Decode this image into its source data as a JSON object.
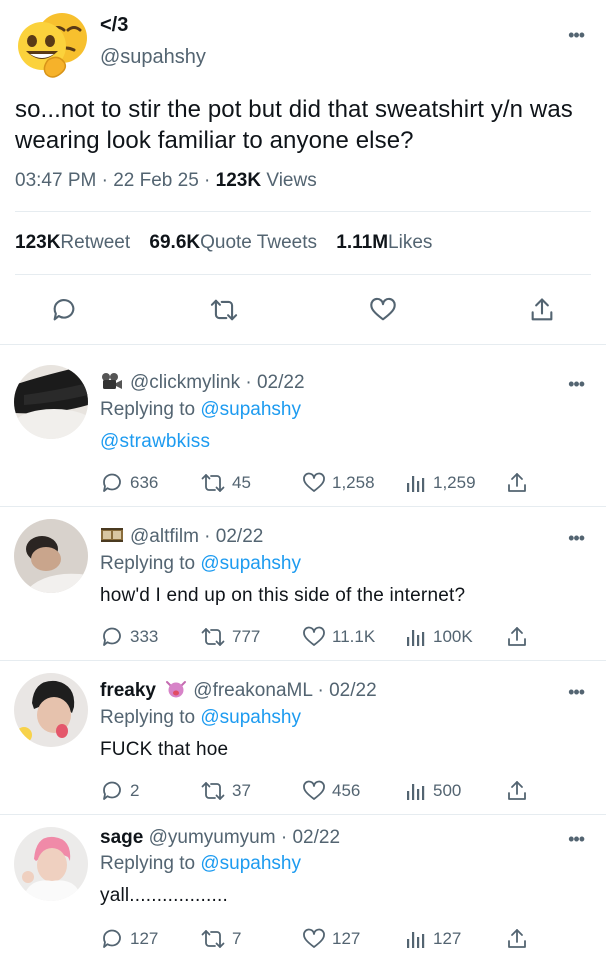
{
  "main": {
    "display_name": "</3",
    "handle": "@supahshy",
    "text": "so...not to stir the pot but did that sweatshirt y/n was wearing look familiar to anyone else?",
    "time": "03:47 PM · 22 Feb 25 · ",
    "views_count": "123K",
    "views_label": " Views",
    "retweets_count": "123K",
    "retweets_label": " Retweet",
    "quotes_count": "69.6K",
    "quotes_label": " Quote Tweets",
    "likes_count": "1.11M",
    "likes_label": " Likes",
    "more": "•••"
  },
  "replies": [
    {
      "name": "",
      "handle": "@clickmylink",
      "date": " · 02/22",
      "replying_prefix": "Replying to ",
      "replying_to": "@supahshy",
      "text": "@strawbkiss",
      "text_is_link": true,
      "replies": "636",
      "retweets": "45",
      "likes": "1,258",
      "views": "1,259",
      "badge_icon": "movie-camera-icon"
    },
    {
      "name": "",
      "handle": "@altfilm",
      "date": " · 02/22",
      "replying_prefix": "Replying to ",
      "replying_to": "@supahshy",
      "text": "how'd I end up on this side of the internet?",
      "text_is_link": false,
      "replies": "333",
      "retweets": "777",
      "likes": "11.1K",
      "views": "100K",
      "badge_icon": "film-frames-icon"
    },
    {
      "name": "freaky",
      "handle": "@freakonaML",
      "date": " · 02/22",
      "replying_prefix": "Replying to ",
      "replying_to": "@supahshy",
      "text": "FUCK that hoe",
      "text_is_link": false,
      "replies": "2",
      "retweets": "37",
      "likes": "456",
      "views": "500",
      "badge_icon": "tongue-face-icon"
    },
    {
      "name": "sage",
      "handle": "@yumyumyum",
      "date": " · 02/22",
      "replying_prefix": "Replying to ",
      "replying_to": "@supahshy",
      "text": "yall..................",
      "text_is_link": false,
      "replies": "127",
      "retweets": "7",
      "likes": "127",
      "views": "127",
      "badge_icon": ""
    }
  ],
  "colors": {
    "accent": "#1d9bf0",
    "muted": "#536471",
    "text": "#0f1419",
    "divider": "#e6ecf0"
  }
}
